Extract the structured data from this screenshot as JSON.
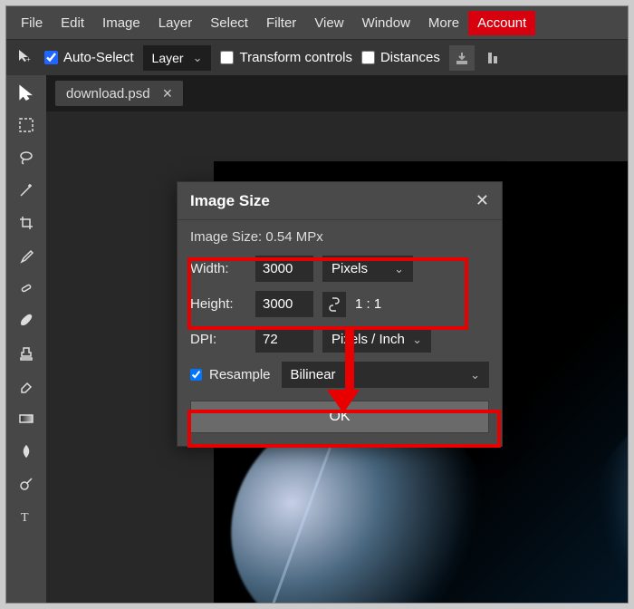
{
  "menu": [
    "File",
    "Edit",
    "Image",
    "Layer",
    "Select",
    "Filter",
    "View",
    "Window",
    "More",
    "Account"
  ],
  "options": {
    "auto_select_label": "Auto-Select",
    "auto_select_checked": true,
    "target_dropdown": "Layer",
    "transform_controls_label": "Transform controls",
    "transform_controls_checked": false,
    "distances_label": "Distances",
    "distances_checked": false
  },
  "tab": {
    "filename": "download.psd"
  },
  "dialog": {
    "title": "Image Size",
    "size_text": "Image Size: 0.54 MPx",
    "width_label": "Width:",
    "width_value": "3000",
    "width_unit": "Pixels",
    "height_label": "Height:",
    "height_value": "3000",
    "link_locked": true,
    "aspect_ratio": "1 : 1",
    "dpi_label": "DPI:",
    "dpi_value": "72",
    "dpi_unit": "Pixels / Inch",
    "resample_label": "Resample",
    "resample_checked": true,
    "resample_method": "Bilinear",
    "ok_label": "OK"
  }
}
